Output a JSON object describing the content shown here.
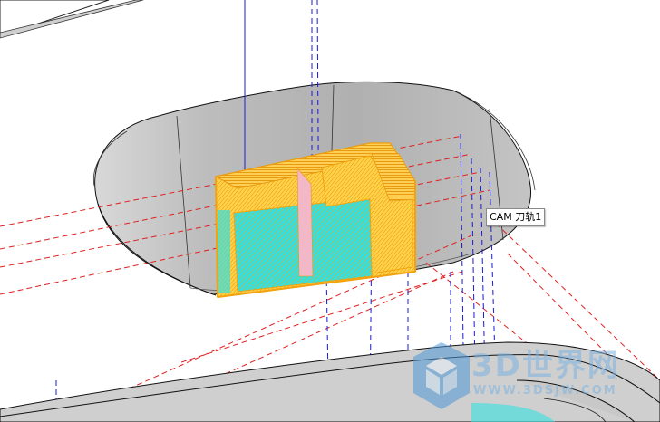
{
  "viewport": {
    "tooltip": {
      "text": "CAM 刀轨1"
    },
    "watermark": {
      "brand": "3D世界网",
      "url": "WWW.3DSJW.COM"
    },
    "colors": {
      "background": "#ffffff",
      "part_face": "#d9d9d9",
      "pocket_wall": "#b8b8b8",
      "edge": "#222222",
      "cut_orange": "#f2a20e",
      "cut_yellow": "#ffd24a",
      "cut_cyan": "#2ee6e6",
      "cut_pink": "#f2b8c8",
      "tool_axis_blue": "#1a1ad9",
      "rapid_red": "#e02020"
    }
  }
}
